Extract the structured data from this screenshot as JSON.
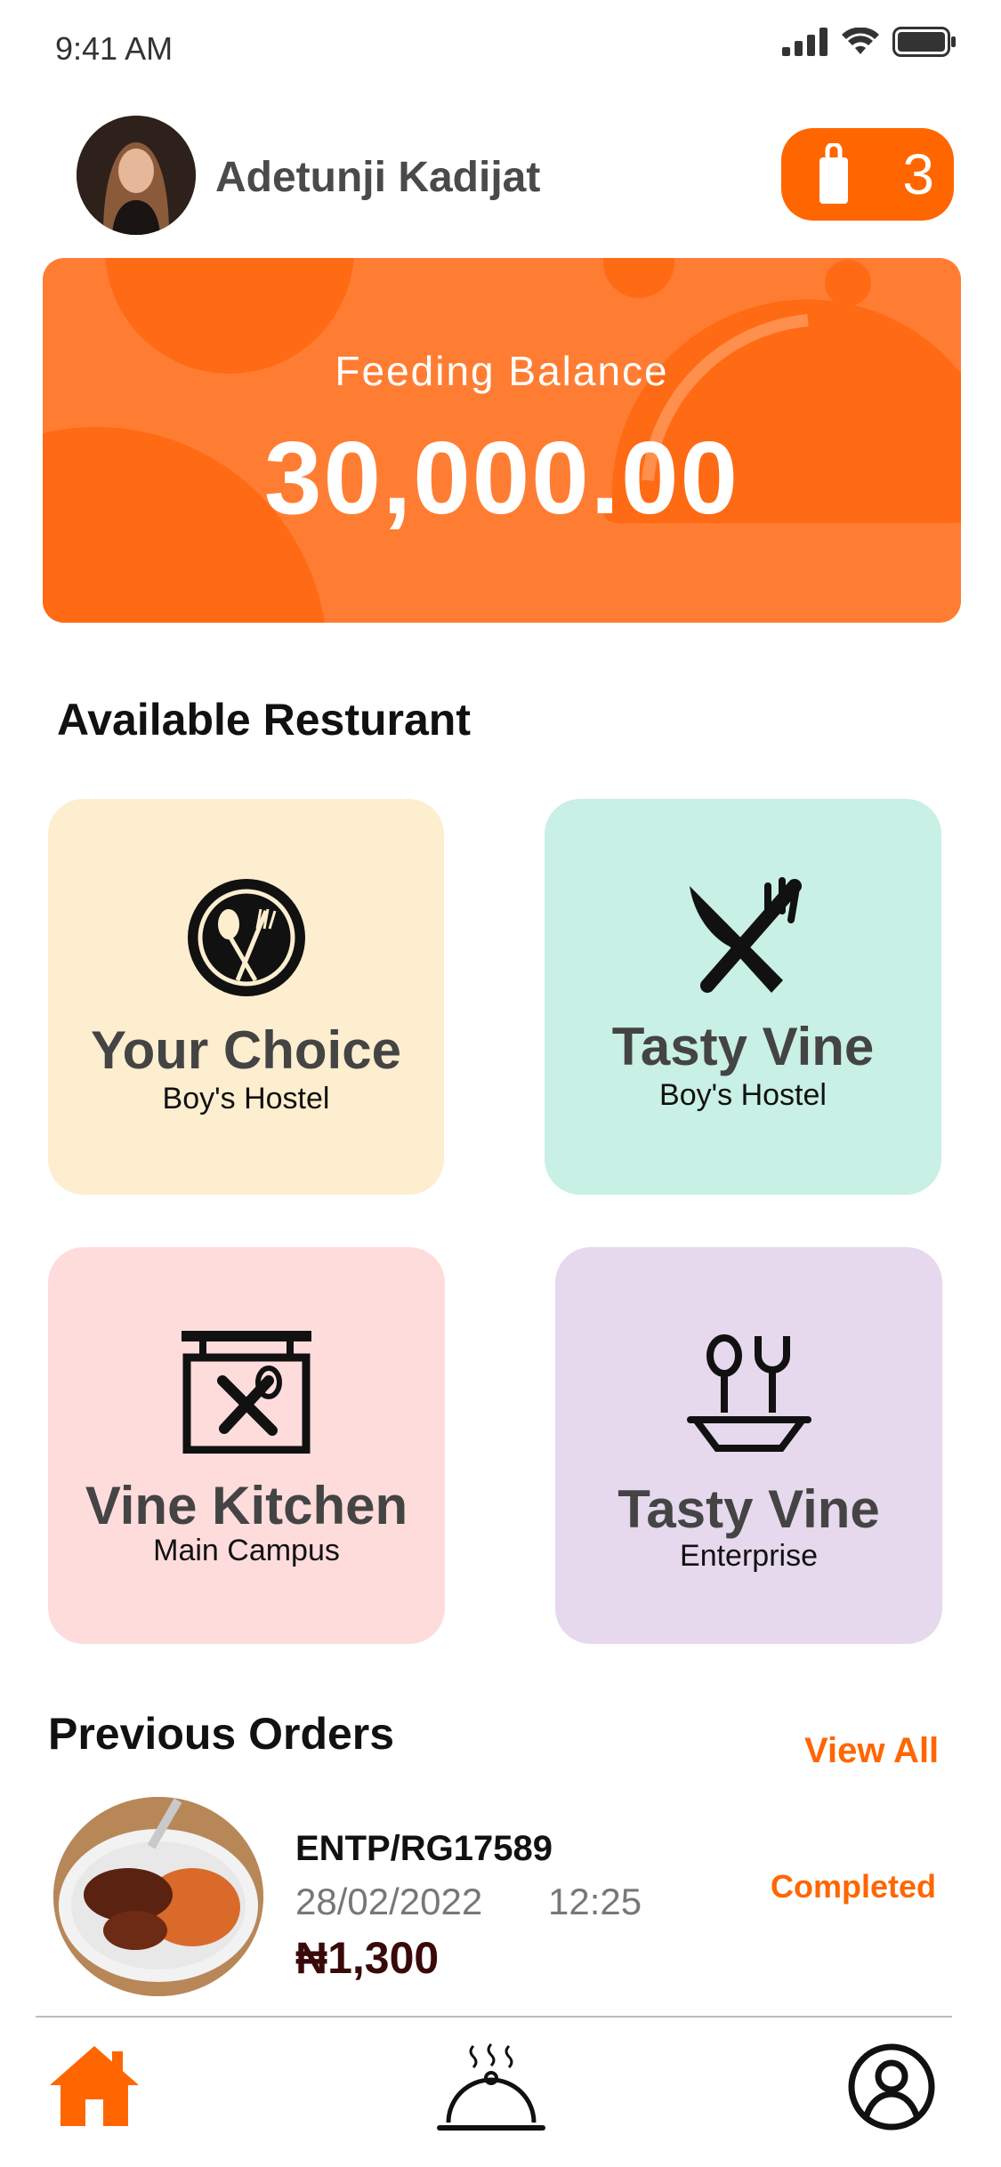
{
  "status_bar": {
    "time": "9:41 AM"
  },
  "header": {
    "user_name": "Adetunji Kadijat",
    "cart_count": "3"
  },
  "balance": {
    "label": "Feeding Balance",
    "amount": "30,000.00"
  },
  "restaurants_section": {
    "title": "Available Resturant"
  },
  "restaurants": [
    {
      "name": "Your Choice",
      "location": "Boy's Hostel",
      "bg": "#fdeecf",
      "icon": "spoon-fork-plate-icon"
    },
    {
      "name": "Tasty Vine",
      "location": "Boy's Hostel",
      "bg": "#c8f0e4",
      "icon": "knife-fork-icon"
    },
    {
      "name": "Vine Kitchen",
      "location": "Main Campus",
      "bg": "#ffdcdc",
      "icon": "restaurant-sign-icon"
    },
    {
      "name": "Tasty Vine",
      "location": "Enterprise",
      "bg": "#e6d8ed",
      "icon": "bowl-utensils-icon"
    }
  ],
  "orders_section": {
    "title": "Previous Orders",
    "view_all": "View All"
  },
  "orders": [
    {
      "id": "ENTP/RG17589",
      "date": "28/02/2022",
      "time": "12:25",
      "price": "₦1,300",
      "status": "Completed"
    }
  ],
  "tabbar": {
    "items": [
      "home-icon",
      "food-cloche-icon",
      "profile-icon"
    ]
  },
  "colors": {
    "accent": "#ff6600",
    "balance_card": "#ff7d33"
  }
}
